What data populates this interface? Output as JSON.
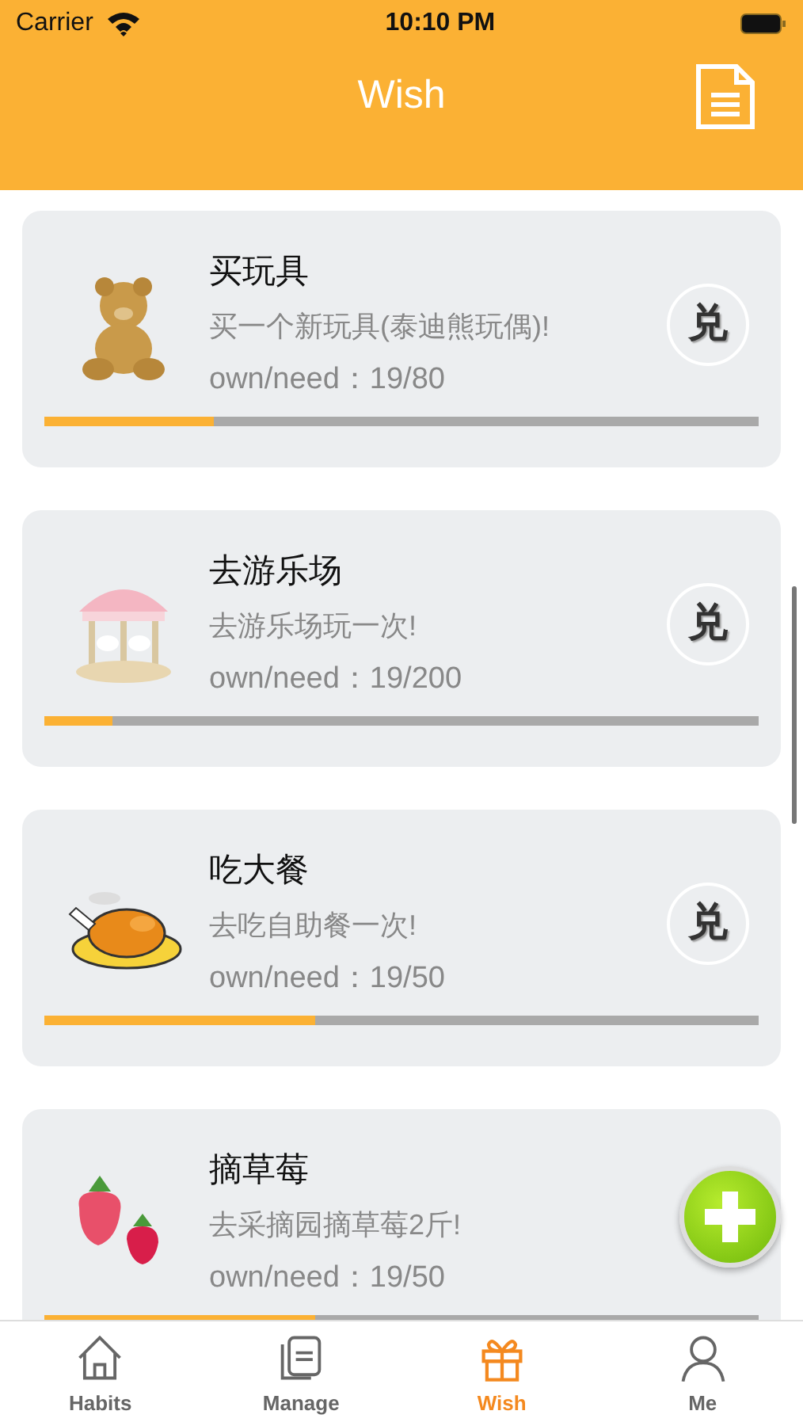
{
  "status_bar": {
    "carrier": "Carrier",
    "time": "10:10 PM"
  },
  "nav": {
    "title": "Wish"
  },
  "wishes": [
    {
      "kind": "bear",
      "title": "买玩具",
      "description": "买一个新玩具(泰迪熊玩偶)!",
      "progress": "own/need：19/80",
      "level": 0.2375,
      "redeem": "兑"
    },
    {
      "kind": "carousel",
      "title": "去游乐场",
      "description": "去游乐场玩一次!",
      "progress": "own/need：19/200",
      "level": 0.095,
      "redeem": "兑"
    },
    {
      "kind": "chicken",
      "title": "吃大餐",
      "description": "去吃自助餐一次!",
      "progress": "own/need：19/50",
      "level": 0.38,
      "redeem": "兑"
    },
    {
      "kind": "strawberry",
      "title": "摘草莓",
      "description": "去采摘园摘草莓2斤!",
      "progress": "own/need：19/50",
      "level": 0.38
    }
  ],
  "tabs": [
    {
      "kind": "home",
      "label": "Habits",
      "selected": false
    },
    {
      "kind": "docs",
      "label": "Manage",
      "selected": false
    },
    {
      "kind": "gift",
      "label": "Wish",
      "selected": true
    },
    {
      "kind": "person",
      "label": "Me",
      "selected": false
    }
  ]
}
